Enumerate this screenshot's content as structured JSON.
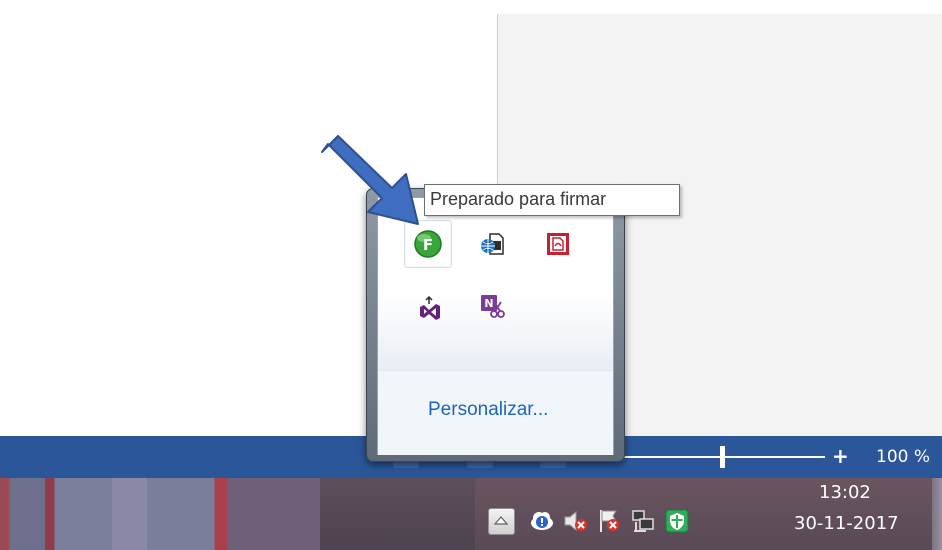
{
  "tooltip": {
    "text": "Preparado para firmar"
  },
  "tray_flyout": {
    "icons": [
      {
        "name": "autofirma-icon",
        "color": "#3aa53a",
        "hovered": true
      },
      {
        "name": "globe-document-icon",
        "color": "#1a78c8"
      },
      {
        "name": "pdf-document-icon",
        "color": "#c8202f"
      },
      {
        "name": "visual-studio-icon",
        "color": "#68217a"
      },
      {
        "name": "onenote-clipper-icon",
        "color": "#7b3b99"
      }
    ],
    "customize_label": "Personalizar..."
  },
  "status_bar": {
    "zoom_in_label": "+",
    "zoom_level": "100 %",
    "zoom_fraction": 0.5,
    "color": "#2b579a"
  },
  "taskbar": {
    "tray_icons": [
      "show-hidden-icons-chevron-icon",
      "cloud-sync-alert-icon",
      "speaker-muted-icon",
      "action-center-flag-error-icon",
      "network-icon",
      "security-shield-icon"
    ],
    "clock": {
      "time": "13:02",
      "date": "30-11-2017"
    }
  },
  "annotation": {
    "arrow_color": "#3f6dbf"
  }
}
